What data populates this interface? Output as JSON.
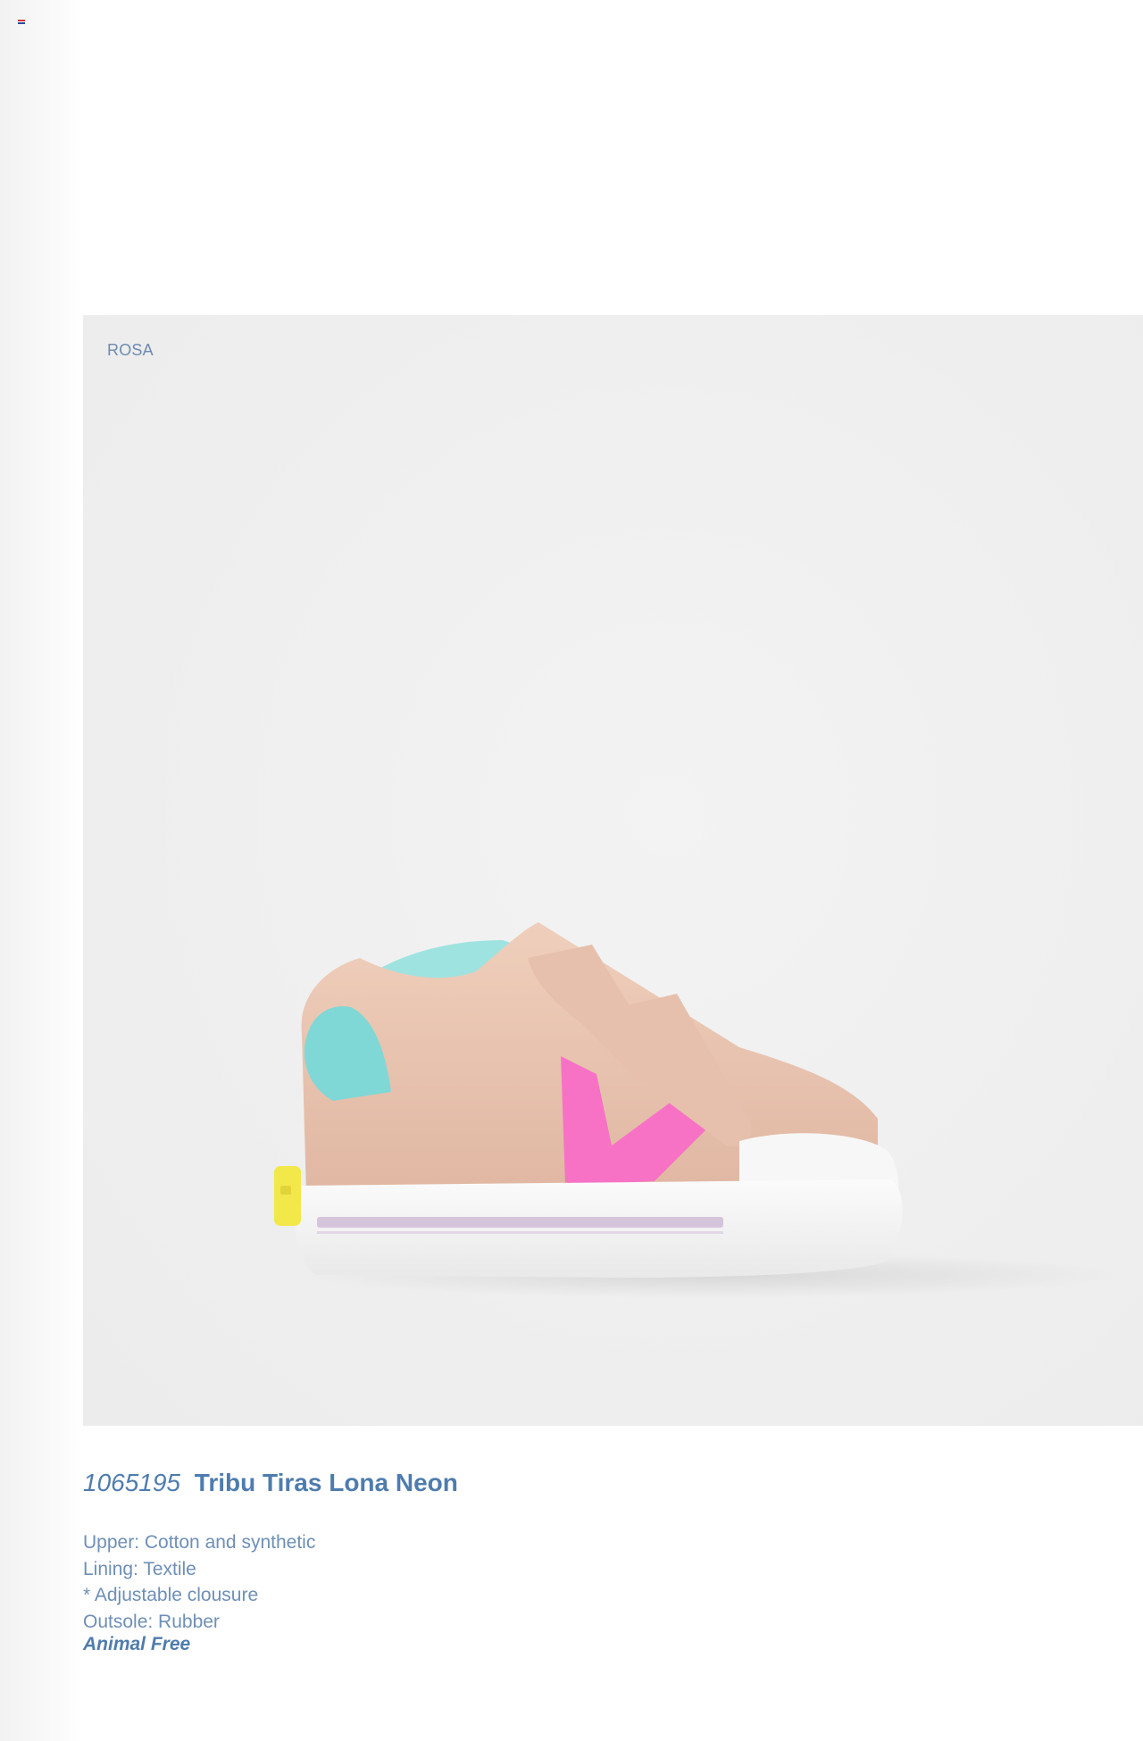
{
  "sidebar": {
    "flag_icon": "language-flag-icon",
    "flag_colors": [
      "#d3383b",
      "#ffffff",
      "#2c4aa0"
    ]
  },
  "product": {
    "color_label": "ROSA",
    "code": "1065195",
    "name": "Tribu Tiras Lona Neon",
    "specs": [
      "Upper: Cotton and synthetic",
      "Lining: Textile",
      "* Adjustable clousure",
      "Outsole: Rubber"
    ],
    "badge": "Animal Free",
    "image_icon": "pink-velcro-sneaker-photo"
  },
  "colors": {
    "accent": "#4f7cae",
    "text": "#6e8fb6",
    "photo_bg": "#efefef",
    "shoe_upper": "#e8c3ae",
    "shoe_v": "#f772c5",
    "heel_tab": "#7fd8d6",
    "heel_logo": "#f2e84a"
  }
}
